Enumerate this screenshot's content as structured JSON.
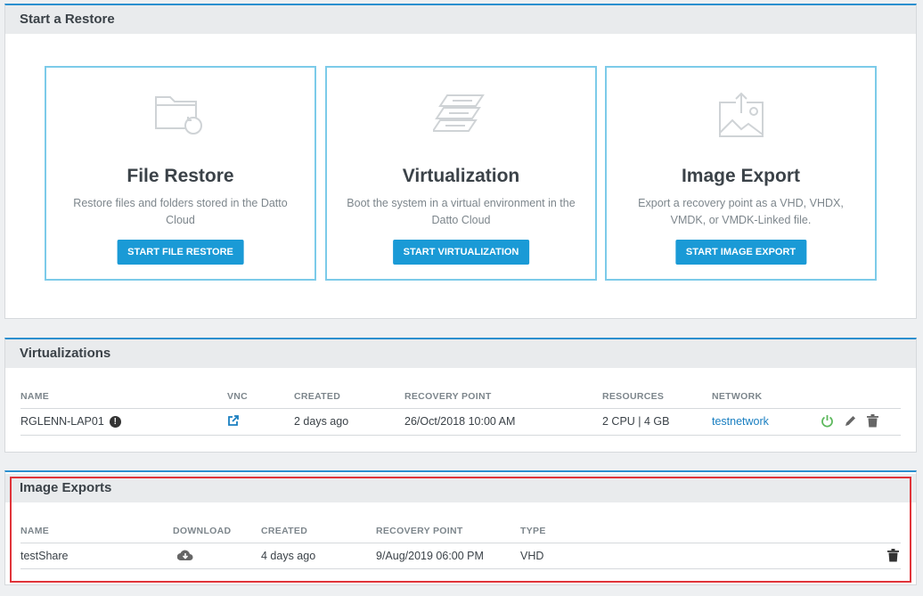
{
  "restore": {
    "header": "Start a Restore",
    "cards": [
      {
        "title": "File Restore",
        "desc": "Restore files and folders stored in the Datto Cloud",
        "button": "START FILE RESTORE",
        "icon": "folder-restore-icon"
      },
      {
        "title": "Virtualization",
        "desc": "Boot the system in a virtual environment in the Datto Cloud",
        "button": "START VIRTUALIZATION",
        "icon": "layers-icon"
      },
      {
        "title": "Image Export",
        "desc": "Export a recovery point as a VHD, VHDX, VMDK, or VMDK-Linked file.",
        "button": "START IMAGE EXPORT",
        "icon": "image-export-icon"
      }
    ]
  },
  "virtualizations": {
    "header": "Virtualizations",
    "columns": {
      "name": "NAME",
      "vnc": "VNC",
      "created": "CREATED",
      "recovery": "RECOVERY POINT",
      "resources": "RESOURCES",
      "network": "NETWORK"
    },
    "row": {
      "name": "RGLENN-LAP01",
      "info": "!",
      "created": "2 days ago",
      "recovery": "26/Oct/2018 10:00 AM",
      "resources": "2 CPU | 4 GB",
      "network": "testnetwork"
    }
  },
  "image_exports": {
    "header": "Image Exports",
    "columns": {
      "name": "NAME",
      "download": "DOWNLOAD",
      "created": "CREATED",
      "recovery": "RECOVERY POINT",
      "type": "TYPE"
    },
    "row": {
      "name": "testShare",
      "created": "4 days ago",
      "recovery": "9/Aug/2019 06:00 PM",
      "type": "VHD"
    }
  },
  "colors": {
    "accent": "#1a9ad6",
    "card_border": "#7ccbe9",
    "highlight": "#e0343a",
    "power": "#5cb85c"
  }
}
